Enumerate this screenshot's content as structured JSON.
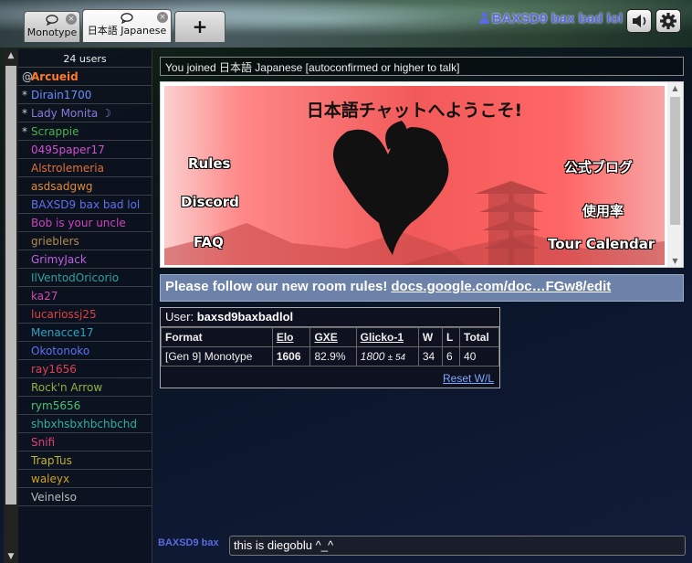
{
  "tabs": [
    {
      "label": "Monotype",
      "close": "×"
    },
    {
      "label": "日本語 Japanese",
      "close": "×"
    }
  ],
  "new_tab_label": "+",
  "header": {
    "user_name": "BAXSD9 bax bad lol"
  },
  "userlist": {
    "count": "24 users",
    "users": [
      {
        "rank": "@",
        "name": "Arcueid",
        "color": "#ff7a2a",
        "bold": true
      },
      {
        "rank": "*",
        "name": "Dirain1700",
        "color": "#6b8cff"
      },
      {
        "rank": "*",
        "name": "Lady Monita ☽",
        "color": "#8a7ae0"
      },
      {
        "rank": "*",
        "name": "Scrappie",
        "color": "#4caf50"
      },
      {
        "rank": "",
        "name": "0495paper17",
        "color": "#d050d0"
      },
      {
        "rank": "",
        "name": "Alstrolemeria",
        "color": "#e0703a"
      },
      {
        "rank": "",
        "name": "asdsadgwg",
        "color": "#e08a3a"
      },
      {
        "rank": "",
        "name": "BAXSD9 bax bad lol",
        "color": "#6070f0"
      },
      {
        "rank": "",
        "name": "Bob is your uncle",
        "color": "#d040c0"
      },
      {
        "rank": "",
        "name": "grieblers",
        "color": "#b08a50"
      },
      {
        "rank": "",
        "name": "GrimyJack",
        "color": "#c060e0"
      },
      {
        "rank": "",
        "name": "IlVentodOricorio",
        "color": "#30a0a0"
      },
      {
        "rank": "",
        "name": "ka27",
        "color": "#d04ab0"
      },
      {
        "rank": "",
        "name": "lucariossj25",
        "color": "#e04040"
      },
      {
        "rank": "",
        "name": "Menacce17",
        "color": "#30a0c0"
      },
      {
        "rank": "",
        "name": "Okotonoko",
        "color": "#6070f0"
      },
      {
        "rank": "",
        "name": "ray1656",
        "color": "#e04050"
      },
      {
        "rank": "",
        "name": "Rock'n Arrow",
        "color": "#90b040"
      },
      {
        "rank": "",
        "name": "rym5656",
        "color": "#50c070"
      },
      {
        "rank": "",
        "name": "shbxhsbxhbchbchd",
        "color": "#30b0a0"
      },
      {
        "rank": "",
        "name": "Snifi",
        "color": "#e04070"
      },
      {
        "rank": "",
        "name": "TrapTus",
        "color": "#c0b030"
      },
      {
        "rank": "",
        "name": "waleyx",
        "color": "#d0a020"
      },
      {
        "rank": "",
        "name": "Veinelso",
        "color": "#bbbbbb"
      }
    ]
  },
  "chat": {
    "joined_message": "You joined 日本語 Japanese [autoconfirmed or higher to talk]",
    "banner": {
      "title": "日本語チャットへようこそ!",
      "left_links": [
        "Rules",
        "Discord",
        "FAQ"
      ],
      "right_links": [
        "公式ブログ",
        "使用率",
        "Tour Calendar"
      ]
    },
    "rules_notice": {
      "text": "Please follow our new room rules!",
      "link": "docs.google.com/doc…FGw8/edit"
    },
    "stats": {
      "user_label": "User:",
      "user": "baxsd9baxbadlol",
      "headers": [
        "Format",
        "Elo",
        "GXE",
        "Glicko-1",
        "W",
        "L",
        "Total"
      ],
      "row": {
        "format": "[Gen 9] Monotype",
        "elo": "1606",
        "gxe": "82.9%",
        "glicko": "1800",
        "glicko_dev": "± 54",
        "w": "34",
        "l": "6",
        "total": "40"
      },
      "reset_label": "Reset W/L"
    }
  },
  "composer": {
    "label": "BAXSD9 bax",
    "value": "this is diegoblu ^_^"
  }
}
